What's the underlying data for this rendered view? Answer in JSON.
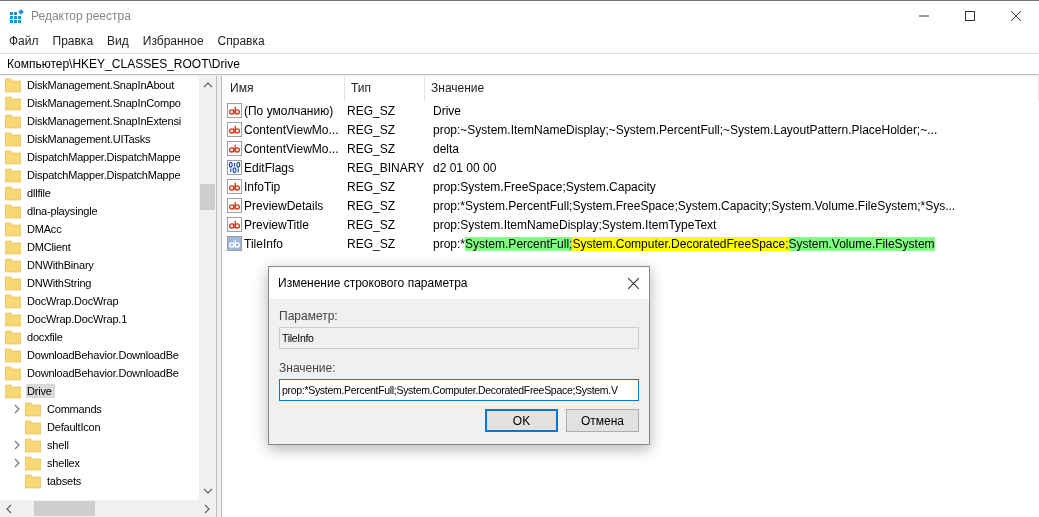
{
  "window": {
    "title": "Редактор реестра"
  },
  "menu": [
    "Файл",
    "Правка",
    "Вид",
    "Избранное",
    "Справка"
  ],
  "address": "Компьютер\\HKEY_CLASSES_ROOT\\Drive",
  "tree": [
    {
      "label": "DiskManagement.SnapInAbout",
      "selected": false
    },
    {
      "label": "DiskManagement.SnapInCompo",
      "selected": false
    },
    {
      "label": "DiskManagement.SnapInExtensi",
      "selected": false
    },
    {
      "label": "DiskManagement.UITasks",
      "selected": false
    },
    {
      "label": "DispatchMapper.DispatchMappe",
      "selected": false
    },
    {
      "label": "DispatchMapper.DispatchMappe",
      "selected": false
    },
    {
      "label": "dllfile",
      "selected": false
    },
    {
      "label": "dlna-playsingle",
      "selected": false
    },
    {
      "label": "DMAcc",
      "selected": false
    },
    {
      "label": "DMClient",
      "selected": false
    },
    {
      "label": "DNWithBinary",
      "selected": false
    },
    {
      "label": "DNWithString",
      "selected": false
    },
    {
      "label": "DocWrap.DocWrap",
      "selected": false
    },
    {
      "label": "DocWrap.DocWrap.1",
      "selected": false
    },
    {
      "label": "docxfile",
      "selected": false
    },
    {
      "label": "DownloadBehavior.DownloadBe",
      "selected": false
    },
    {
      "label": "DownloadBehavior.DownloadBe",
      "selected": false
    },
    {
      "label": "Drive",
      "selected": true,
      "children": [
        {
          "label": "Commands",
          "selected": false,
          "expandable": true
        },
        {
          "label": "DefaultIcon",
          "selected": false,
          "expandable": false
        },
        {
          "label": "shell",
          "selected": false,
          "expandable": true
        },
        {
          "label": "shellex",
          "selected": false,
          "expandable": true
        },
        {
          "label": "tabsets",
          "selected": false,
          "expandable": false
        }
      ]
    }
  ],
  "columns": [
    "Имя",
    "Тип",
    "Значение"
  ],
  "values": [
    {
      "kind": "string",
      "name": "(По умолчанию)",
      "type": "REG_SZ",
      "selected": false,
      "value": [
        {
          "text": "Drive"
        }
      ]
    },
    {
      "kind": "string",
      "name": "ContentViewMo...",
      "type": "REG_SZ",
      "selected": false,
      "value": [
        {
          "text": "prop:~System.ItemNameDisplay;~System.PercentFull;~System.LayoutPattern.PlaceHolder;~..."
        }
      ]
    },
    {
      "kind": "string",
      "name": "ContentViewMo...",
      "type": "REG_SZ",
      "selected": false,
      "value": [
        {
          "text": "delta"
        }
      ]
    },
    {
      "kind": "binary",
      "name": "EditFlags",
      "type": "REG_BINARY",
      "selected": false,
      "value": [
        {
          "text": "d2 01 00 00"
        }
      ]
    },
    {
      "kind": "string",
      "name": "InfoTip",
      "type": "REG_SZ",
      "selected": false,
      "value": [
        {
          "text": "prop:System.FreeSpace;System.Capacity"
        }
      ]
    },
    {
      "kind": "string",
      "name": "PreviewDetails",
      "type": "REG_SZ",
      "selected": false,
      "value": [
        {
          "text": "prop:*System.PercentFull;System.FreeSpace;System.Capacity;System.Volume.FileSystem;*Sys..."
        }
      ]
    },
    {
      "kind": "string",
      "name": "PreviewTitle",
      "type": "REG_SZ",
      "selected": false,
      "value": [
        {
          "text": "prop:System.ItemNameDisplay;System.ItemTypeText"
        }
      ]
    },
    {
      "kind": "string",
      "name": "TileInfo",
      "type": "REG_SZ",
      "selected": true,
      "value": [
        {
          "text": "prop:*"
        },
        {
          "text": "System.PercentFull;",
          "color": "#80ff80"
        },
        {
          "text": "System.Computer.DecoratedFreeSpace;",
          "color": "#ffff00"
        },
        {
          "text": "System.Volume.FileSystem",
          "color": "#80ff80"
        }
      ]
    }
  ],
  "dialog": {
    "title": "Изменение строкового параметра",
    "name_label": "Параметр:",
    "name_value": "TileInfo",
    "value_label": "Значение:",
    "value": "prop:*System.PercentFull;System.Computer.DecoratedFreeSpace;System.V",
    "ok": "OK",
    "cancel": "Отмена"
  }
}
